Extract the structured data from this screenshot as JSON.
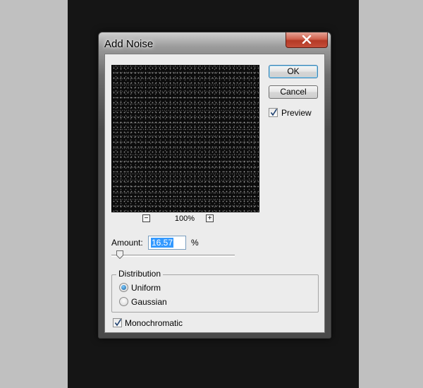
{
  "dialog": {
    "title": "Add Noise",
    "close_icon": "close-icon"
  },
  "preview": {
    "zoom_out_label": "−",
    "zoom_in_label": "+",
    "zoom_level": "100%"
  },
  "buttons": {
    "ok_label": "OK",
    "cancel_label": "Cancel"
  },
  "preview_toggle": {
    "label": "Preview",
    "checked": true
  },
  "amount": {
    "label": "Amount:",
    "value": "16.57",
    "unit": "%",
    "slider_fraction": 0.0414
  },
  "distribution": {
    "title": "Distribution",
    "options": [
      {
        "label": "Uniform",
        "selected": true
      },
      {
        "label": "Gaussian",
        "selected": false
      }
    ]
  },
  "monochromatic": {
    "label": "Monochromatic",
    "checked": true
  },
  "colors": {
    "close_button": "#c54e3a",
    "selection_highlight": "#3399ff",
    "dialog_client": "#ececec",
    "canvas_background": "#151515"
  }
}
